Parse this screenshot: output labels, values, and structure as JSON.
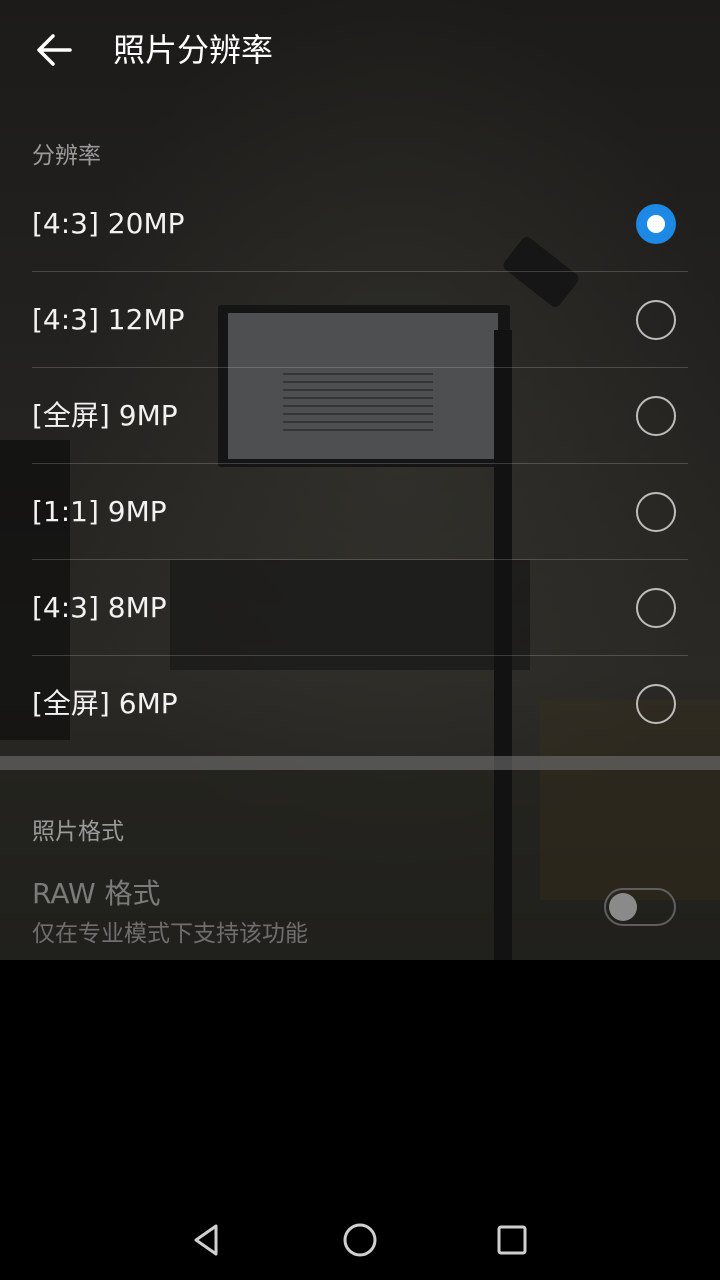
{
  "header": {
    "title": "照片分辨率",
    "back_icon": "arrow-left-icon"
  },
  "resolution_section": {
    "label": "分辨率",
    "options": [
      {
        "label": "[4:3] 20MP",
        "selected": true
      },
      {
        "label": "[4:3] 12MP",
        "selected": false
      },
      {
        "label": "[全屏] 9MP",
        "selected": false
      },
      {
        "label": "[1:1] 9MP",
        "selected": false
      },
      {
        "label": "[4:3] 8MP",
        "selected": false
      },
      {
        "label": "[全屏] 6MP",
        "selected": false
      }
    ]
  },
  "format_section": {
    "label": "照片格式",
    "raw_title": "RAW 格式",
    "raw_subtitle": "仅在专业模式下支持该功能",
    "raw_enabled": false
  },
  "colors": {
    "accent": "#1e88e5"
  },
  "navbar": {
    "icons": [
      "back-triangle-icon",
      "home-circle-icon",
      "recents-square-icon"
    ]
  }
}
